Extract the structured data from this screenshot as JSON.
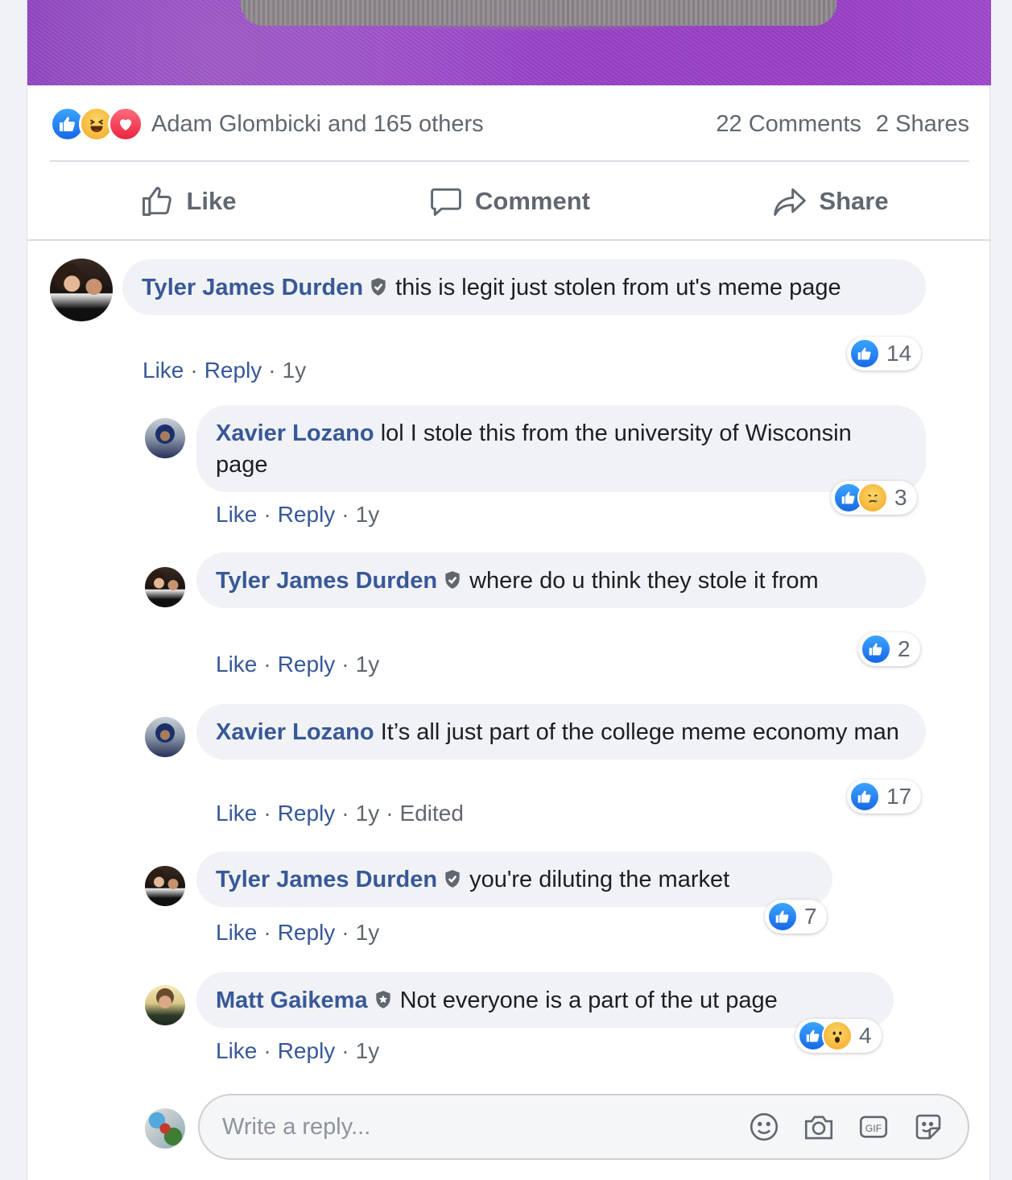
{
  "post": {
    "reaction_summary": "Adam Glombicki and 165 others",
    "comments_count": "22 Comments",
    "shares_count": "2 Shares"
  },
  "actions": {
    "like": "Like",
    "comment": "Comment",
    "share": "Share"
  },
  "comments": [
    {
      "author": "Tyler James Durden",
      "text": "this is legit just stolen from ut's meme page",
      "like": "Like",
      "reply": "Reply",
      "time": "1y",
      "reaction_count": "14"
    },
    {
      "author": "Xavier Lozano",
      "text": "lol I stole this from the university of Wisconsin page",
      "like": "Like",
      "reply": "Reply",
      "time": "1y",
      "reaction_count": "3"
    },
    {
      "author": "Tyler James Durden",
      "text": "where do u think they stole it from",
      "like": "Like",
      "reply": "Reply",
      "time": "1y",
      "reaction_count": "2"
    },
    {
      "author": "Xavier Lozano",
      "text": "It’s all just part of the college meme economy man",
      "like": "Like",
      "reply": "Reply",
      "time": "1y",
      "edited": "Edited",
      "reaction_count": "17"
    },
    {
      "author": "Tyler James Durden",
      "text": "you're diluting the market",
      "like": "Like",
      "reply": "Reply",
      "time": "1y",
      "reaction_count": "7"
    },
    {
      "author": "Matt Gaikema",
      "text": "Not everyone is a part of the ut page",
      "like": "Like",
      "reply": "Reply",
      "time": "1y",
      "reaction_count": "4"
    }
  ],
  "reply_box": {
    "placeholder": "Write a reply..."
  },
  "colors": {
    "author_link": "#385898",
    "meta_text": "#606770",
    "bubble_bg": "#f0f2f5",
    "like_blue": "#1877f2"
  },
  "icons": {
    "reactions": [
      "like-icon",
      "haha-icon",
      "love-icon",
      "sad-icon",
      "wow-icon"
    ],
    "reply_tools": [
      "emoji-icon",
      "camera-icon",
      "gif-icon",
      "sticker-icon"
    ],
    "badges": [
      "verified-shield-icon"
    ]
  }
}
